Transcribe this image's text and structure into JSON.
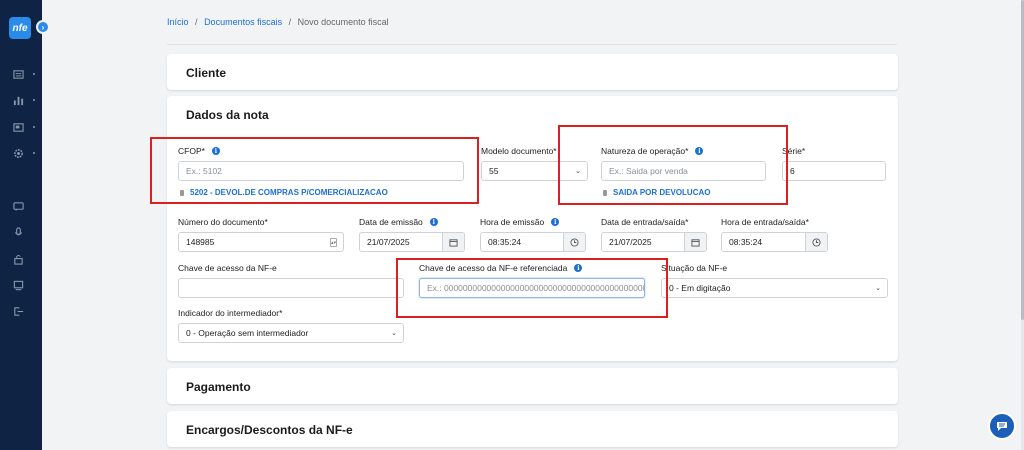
{
  "app": {
    "logo_text": "nfe"
  },
  "sidebar": {
    "items": [
      {
        "icon": "dashboard-icon"
      },
      {
        "icon": "bar-chart-icon"
      },
      {
        "icon": "folder-icon"
      },
      {
        "icon": "settings-gear-icon"
      },
      {
        "icon": "chat-icon"
      },
      {
        "icon": "microphone-icon"
      },
      {
        "icon": "lock-icon"
      },
      {
        "icon": "monitor-icon"
      },
      {
        "icon": "logout-icon"
      }
    ]
  },
  "breadcrumb": {
    "home": "Início",
    "sep1": "/",
    "docs": "Documentos fiscais",
    "sep2": "/",
    "current": "Novo documento fiscal"
  },
  "sections": {
    "cliente": "Cliente",
    "dados": "Dados da nota",
    "pagamento": "Pagamento",
    "encargos": "Encargos/Descontos da NF-e"
  },
  "form": {
    "cfop": {
      "label": "CFOP*",
      "placeholder": "Ex.: 5102",
      "hint": "5202 - DEVOL.DE COMPRAS P/COMERCIALIZACAO"
    },
    "modelo": {
      "label": "Modelo documento*",
      "value": "55"
    },
    "natureza": {
      "label": "Natureza de operação*",
      "placeholder": "Ex.:  Saida por venda",
      "hint": "SAIDA POR DEVOLUCAO"
    },
    "serie": {
      "label": "Série*",
      "value": "6"
    },
    "numero": {
      "label": "Número do documento*",
      "value": "148985"
    },
    "data_emissao": {
      "label": "Data de emissão",
      "value": "21/07/2025"
    },
    "hora_emissao": {
      "label": "Hora de emissão",
      "value": "08:35:24"
    },
    "data_entrada": {
      "label": "Data de entrada/saída*",
      "value": "21/07/2025"
    },
    "hora_entrada": {
      "label": "Hora de entrada/saída*",
      "value": "08:35:24"
    },
    "chave": {
      "label": "Chave de acesso da NF-e",
      "value": ""
    },
    "chave_ref": {
      "label": "Chave de acesso da NF-e referenciada",
      "placeholder": "Ex.: 00000000000000000000000000000000000000000000"
    },
    "situacao": {
      "label": "Situação da NF-e",
      "value": "0 - Em digitação"
    },
    "intermediador": {
      "label": "Indicador do intermediador*",
      "value": "0 - Operação sem intermediador"
    }
  },
  "colors": {
    "sidebar_bg": "#0f2344",
    "accent": "#1c6fd6",
    "highlight": "#d9211f"
  }
}
